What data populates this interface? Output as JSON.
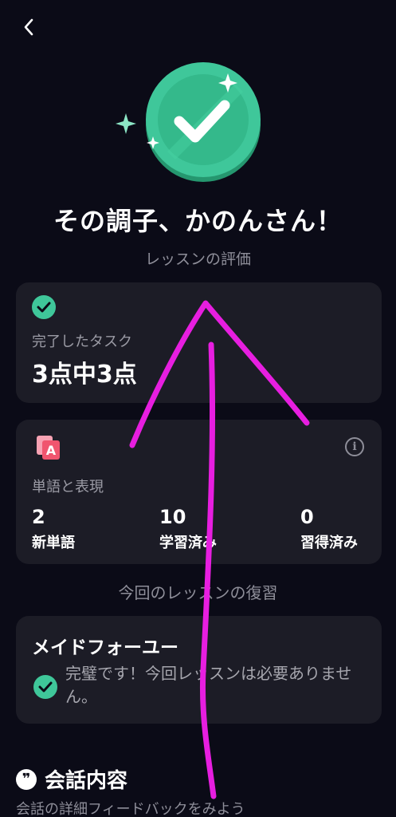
{
  "header": {
    "back_icon": "chevron-left-icon"
  },
  "hero": {
    "icon": "check-medal-icon",
    "colors": {
      "accent": "#3fc79a",
      "dark": "#2a9a74",
      "sparkle": "#a8f0d6"
    }
  },
  "title": "その調子、かのんさん！",
  "subtitle": "レッスンの評価",
  "tasks_card": {
    "icon": "check-circle-icon",
    "label": "完了したタスク",
    "value": "3点中3点"
  },
  "vocab_card": {
    "icon": "vocabulary-cards-icon",
    "info_icon": "info-icon",
    "info_glyph": "i",
    "label": "単語と表現",
    "stats": [
      {
        "value": "2",
        "label": "新単語"
      },
      {
        "value": "10",
        "label": "学習済み"
      },
      {
        "value": "0",
        "label": "習得済み"
      }
    ]
  },
  "review_section_label": "今回のレッスンの復習",
  "review_card": {
    "title": "メイドフォーユー",
    "icon": "check-circle-icon",
    "message": "完璧です！今回レッスンは必要ありません。"
  },
  "conversation": {
    "icon": "quote-bubble-icon",
    "icon_glyph": "❞",
    "title": "会話内容",
    "subtitle": "会話の詳細フィードバックをみよう"
  },
  "annotation": {
    "color": "#e71ee0"
  }
}
